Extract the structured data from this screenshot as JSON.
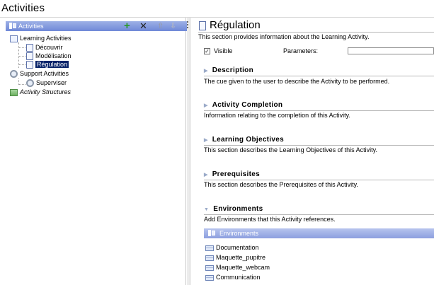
{
  "app": {
    "title": "Activities"
  },
  "left_panel": {
    "header_label": "Activities",
    "toolbar": {
      "add_label": "+",
      "delete_label": "✕",
      "up_label": "⇧",
      "down_label": "⇩"
    },
    "tree": {
      "learning_activities_label": "Learning Activities",
      "learning_children": [
        "Découvrir",
        "Modélisation",
        "Régulation"
      ],
      "selected": "Régulation",
      "support_activities_label": "Support Activities",
      "support_children": [
        "Superviser"
      ],
      "activity_structures_label": "Activity Structures"
    }
  },
  "detail": {
    "title": "Régulation",
    "intro": "This section provides information about the Learning Activity.",
    "visible_label": "Visible",
    "visible_checked": true,
    "parameters_label": "Parameters:",
    "parameters_value": "",
    "sections": [
      {
        "title": "Description",
        "text": "The cue given to the user to describe the Activity to be performed.",
        "expanded": false
      },
      {
        "title": "Activity Completion",
        "text": "Information relating to the completion of this Activity.",
        "expanded": false
      },
      {
        "title": "Learning Objectives",
        "text": "This section describes the Learning Objectives of this Activity.",
        "expanded": false
      },
      {
        "title": "Prerequisites",
        "text": "This section describes the Prerequisites of this Activity.",
        "expanded": false
      },
      {
        "title": "Environments",
        "text": "Add Environments that this Activity references.",
        "expanded": true
      }
    ],
    "environments": {
      "header_label": "Environments",
      "items": [
        "Documentation",
        "Maquette_pupitre",
        "Maquette_webcam",
        "Communication"
      ]
    }
  },
  "colors": {
    "header_blue": "#6f88d8",
    "selection": "#0a246a",
    "add_green": "#2a9a2a"
  }
}
